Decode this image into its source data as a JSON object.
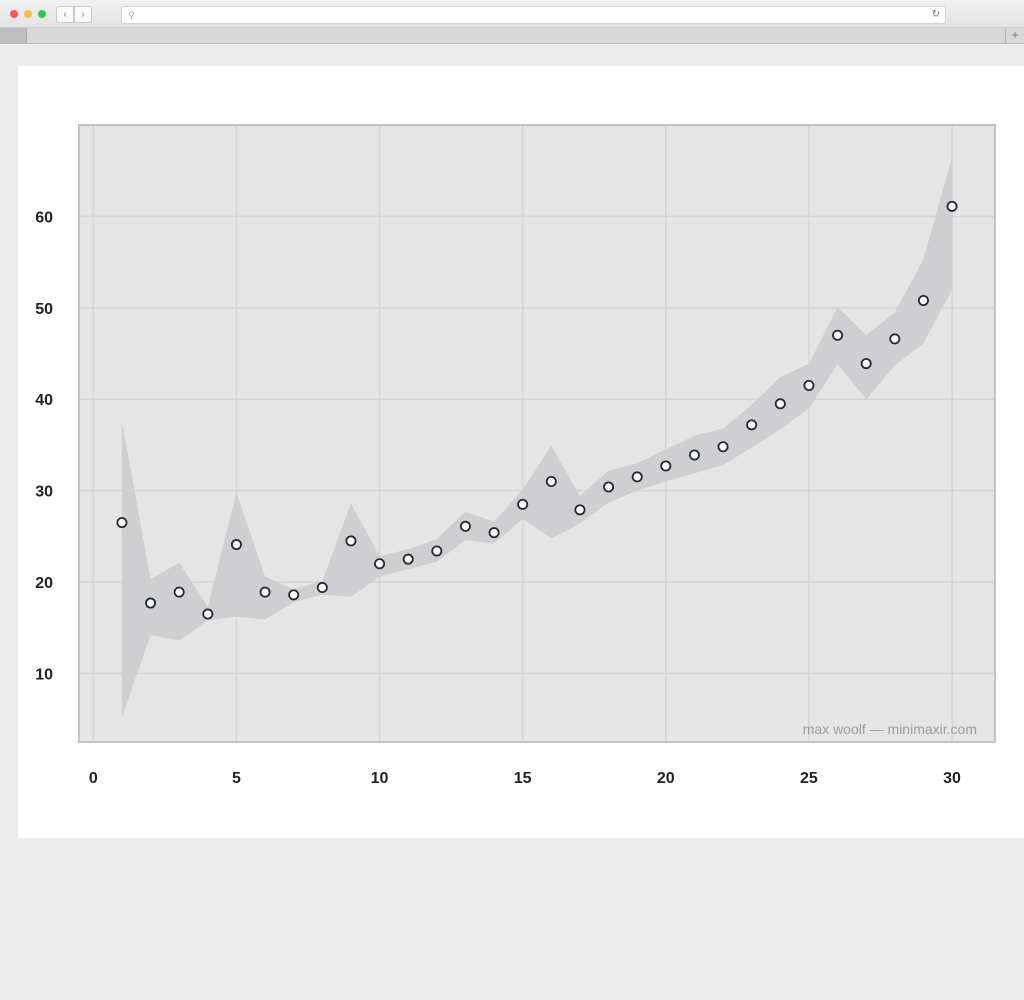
{
  "browser": {
    "search_icon": "search-icon",
    "reload_icon": "reload-icon",
    "new_tab_label": "+"
  },
  "chart_data": {
    "type": "scatter",
    "title": "",
    "xlabel": "",
    "ylabel": "",
    "xlim": [
      -0.5,
      31.5
    ],
    "ylim": [
      2.5,
      70
    ],
    "xticks": [
      0,
      5,
      10,
      15,
      20,
      25,
      30
    ],
    "yticks": [
      10,
      20,
      30,
      40,
      50,
      60
    ],
    "grid": true,
    "x": [
      1,
      2,
      3,
      4,
      5,
      6,
      7,
      8,
      9,
      10,
      11,
      12,
      13,
      14,
      15,
      16,
      17,
      18,
      19,
      20,
      21,
      22,
      23,
      24,
      25,
      26,
      27,
      28,
      29,
      30
    ],
    "y": [
      26.5,
      17.7,
      18.9,
      16.5,
      24.1,
      18.9,
      18.6,
      19.4,
      24.5,
      22.0,
      22.5,
      23.4,
      26.1,
      25.4,
      28.5,
      31.0,
      27.9,
      30.4,
      31.5,
      32.7,
      33.9,
      34.8,
      37.2,
      39.5,
      41.5,
      47.0,
      43.9,
      46.6,
      50.8,
      61.1
    ],
    "ribbon_lower": [
      5.2,
      14.2,
      13.6,
      15.8,
      16.2,
      15.9,
      17.8,
      18.6,
      18.4,
      20.6,
      21.4,
      22.2,
      24.6,
      24.2,
      26.9,
      24.8,
      26.4,
      28.7,
      30.0,
      31.0,
      31.9,
      32.8,
      34.7,
      36.7,
      39.0,
      43.8,
      40.0,
      43.7,
      46.1,
      52.0
    ],
    "ribbon_upper": [
      37.6,
      20.3,
      22.1,
      17.3,
      29.8,
      20.6,
      19.2,
      20.1,
      28.6,
      22.8,
      23.6,
      24.7,
      27.7,
      26.6,
      30.1,
      34.9,
      29.4,
      32.2,
      33.0,
      34.5,
      36.0,
      36.8,
      39.4,
      42.4,
      43.9,
      50.1,
      47.0,
      49.5,
      55.3,
      66.5
    ],
    "colors": {
      "panel": "#e5e5e5",
      "grid": "#d4d4d4",
      "border": "#c3c3c3",
      "ribbon": "#cfcfd1",
      "point_fill": "#ffffff",
      "point_stroke": "#1f2a33"
    },
    "watermark": "max woolf — minimaxir.com"
  }
}
